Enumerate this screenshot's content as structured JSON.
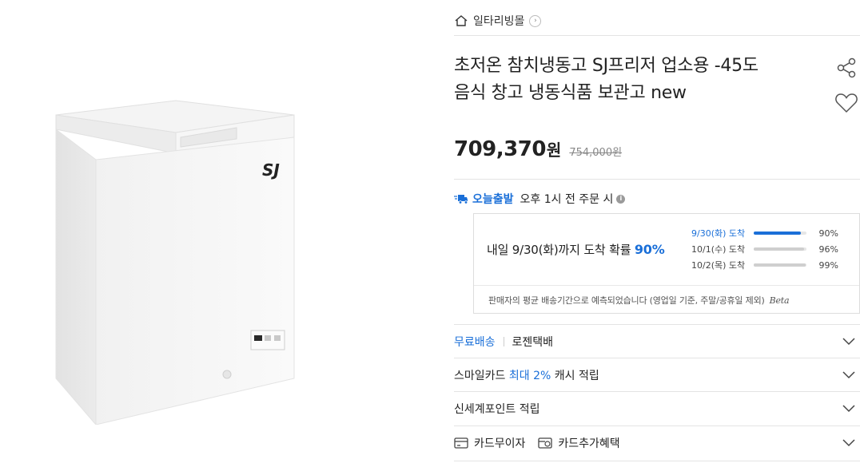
{
  "breadcrumb": {
    "store": "일타리빙몰"
  },
  "product": {
    "title_line1": "초저온 참치냉동고 SJ프리저 업소용 -45도",
    "title_line2": "음식 창고 냉동식품 보관고 new",
    "brand_mark": "SJ",
    "price": "709,370",
    "currency": "원",
    "original_price": "754,000원"
  },
  "delivery": {
    "today_label": "오늘출발",
    "today_text": "오후 1시 전 주문 시",
    "main_prefix": "내일 9/30(화)까지 도착 확률",
    "main_pct": "90%",
    "bars": [
      {
        "label": "9/30(화) 도착",
        "value": "90%",
        "fraction": 0.9
      },
      {
        "label": "10/1(수) 도착",
        "value": "96%",
        "fraction": 0.96
      },
      {
        "label": "10/2(목) 도착",
        "value": "99%",
        "fraction": 0.99
      }
    ],
    "note": "판매자의 평균 배송기간으로 예측되었습니다 (영업일 기준, 주말/공휴일 제외)",
    "beta": "Beta"
  },
  "rows": {
    "shipping_free": "무료배송",
    "shipping_courier": "로젠택배",
    "smilecard_prefix": "스마일카드",
    "smilecard_highlight": "최대 2%",
    "smilecard_suffix": "캐시 적립",
    "shinsegae": "신세계포인트 적립",
    "card_interest": "카드무이자",
    "card_benefit": "카드추가혜택"
  },
  "colors": {
    "accent": "#1a6fd8",
    "text": "#222222",
    "muted": "#888888"
  }
}
